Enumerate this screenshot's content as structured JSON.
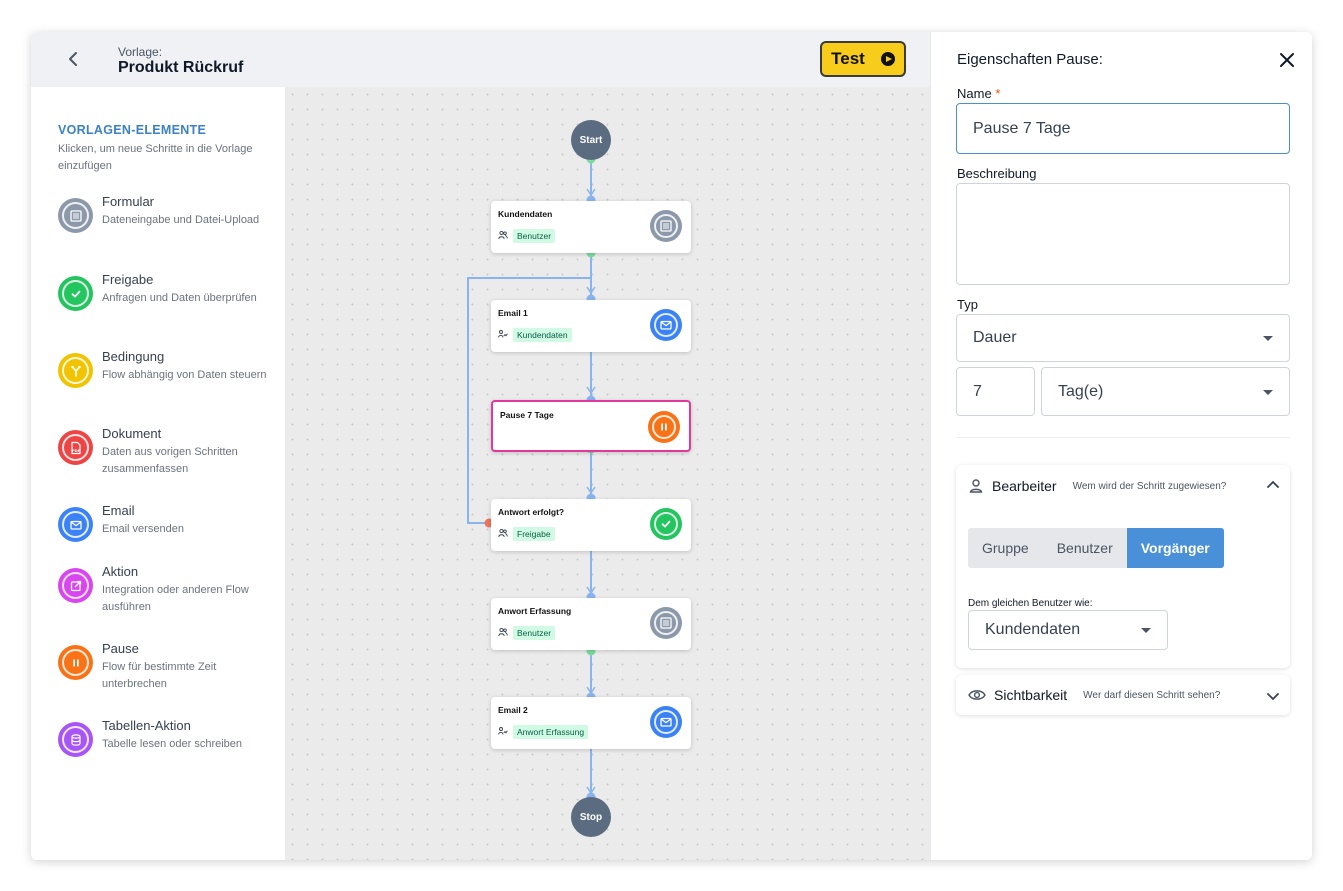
{
  "header": {
    "template_label": "Vorlage:",
    "template_name": "Produkt Rückruf",
    "test_label": "Test"
  },
  "sidebar": {
    "title": "VORLAGEN-ELEMENTE",
    "subtitle": "Klicken, um neue Schritte in die Vorlage einzufügen",
    "elements": [
      {
        "name": "Formular",
        "desc": "Dateneingabe und Datei-Upload",
        "color": "#8c99aa",
        "icon": "form-icon"
      },
      {
        "name": "Freigabe",
        "desc": "Anfragen und Daten überprüfen",
        "color": "#22c55e",
        "icon": "check-icon"
      },
      {
        "name": "Bedingung",
        "desc": "Flow abhängig von Daten steuern",
        "color": "#f2c300",
        "icon": "branch-icon"
      },
      {
        "name": "Dokument",
        "desc": "Daten aus vorigen Schritten zusammenfassen",
        "color": "#ef4444",
        "icon": "pdf-icon"
      },
      {
        "name": "Email",
        "desc": "Email versenden",
        "color": "#3b82f6",
        "icon": "mail-icon"
      },
      {
        "name": "Aktion",
        "desc": "Integration oder anderen Flow ausführen",
        "color": "#d946ef",
        "icon": "external-icon"
      },
      {
        "name": "Pause",
        "desc": "Flow für bestimmte Zeit unterbrechen",
        "color": "#f97316",
        "icon": "pause-icon"
      },
      {
        "name": "Tabellen-Aktion",
        "desc": "Tabelle lesen oder schreiben",
        "color": "#a855f7",
        "icon": "database-icon"
      }
    ]
  },
  "flow": {
    "start": "Start",
    "stop": "Stop",
    "nodes": [
      {
        "title": "Kundendaten",
        "tag": "Benutzer",
        "user_icon": "users-icon",
        "icon": "form-icon",
        "color": "#8c99aa"
      },
      {
        "title": "Email 1",
        "tag": "Kundendaten",
        "user_icon": "user-signature-icon",
        "icon": "mail-icon",
        "color": "#3b82f6"
      },
      {
        "title": "Pause 7 Tage",
        "tag": "",
        "user_icon": "",
        "icon": "pause-icon",
        "color": "#f97316"
      },
      {
        "title": "Antwort erfolgt?",
        "tag": "Freigabe",
        "user_icon": "users-icon",
        "icon": "check-icon",
        "color": "#22c55e"
      },
      {
        "title": "Anwort Erfassung",
        "tag": "Benutzer",
        "user_icon": "users-icon",
        "icon": "form-icon",
        "color": "#8c99aa"
      },
      {
        "title": "Email 2",
        "tag": "Anwort Erfassung",
        "user_icon": "user-signature-icon",
        "icon": "mail-icon",
        "color": "#3b82f6"
      }
    ]
  },
  "panel": {
    "title": "Eigenschaften Pause:",
    "name_label": "Name",
    "name_required": "*",
    "name_value": "Pause 7 Tage",
    "desc_label": "Beschreibung",
    "desc_value": "",
    "type_label": "Typ",
    "type_value": "Dauer",
    "amount_value": "7",
    "unit_value": "Tag(e)",
    "editor": {
      "title": "Bearbeiter",
      "hint": "Wem wird der Schritt zugewiesen?",
      "options": [
        "Gruppe",
        "Benutzer",
        "Vorgänger"
      ],
      "selected": "Vorgänger",
      "same_user_label": "Dem gleichen Benutzer wie:",
      "same_user_value": "Kundendaten"
    },
    "visibility": {
      "title": "Sichtbarkeit",
      "hint": "Wer darf diesen Schritt sehen?"
    }
  },
  "colors": {
    "accent": "#4a90d9",
    "test_button": "#f8cc1b",
    "selected_node_border": "#e0389b",
    "connector": "#8ab4f0",
    "port_out": "#7bdc9b",
    "port_in": "#8ab4f0",
    "port_loop": "#f0735b"
  }
}
